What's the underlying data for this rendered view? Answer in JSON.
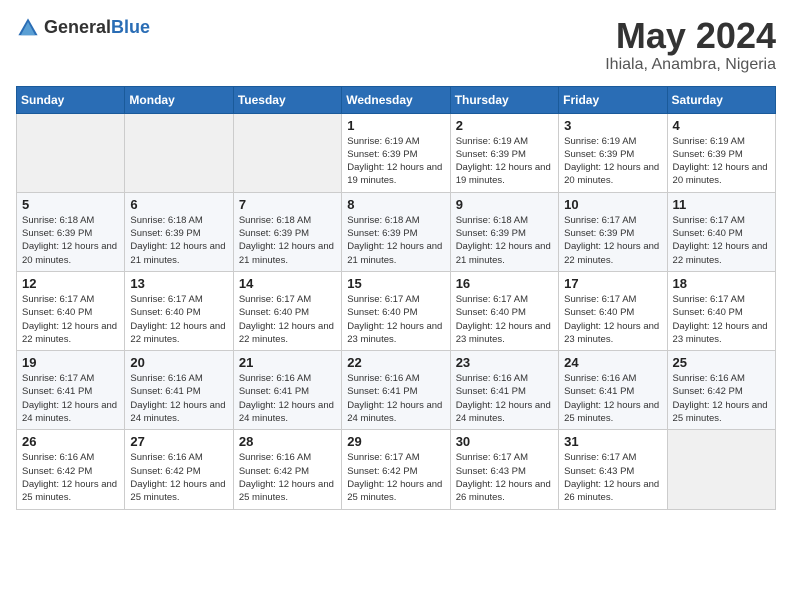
{
  "header": {
    "logo_general": "General",
    "logo_blue": "Blue",
    "month_title": "May 2024",
    "location": "Ihiala, Anambra, Nigeria"
  },
  "days_of_week": [
    "Sunday",
    "Monday",
    "Tuesday",
    "Wednesday",
    "Thursday",
    "Friday",
    "Saturday"
  ],
  "weeks": [
    [
      {
        "day": "",
        "sunrise": "",
        "sunset": "",
        "daylight": ""
      },
      {
        "day": "",
        "sunrise": "",
        "sunset": "",
        "daylight": ""
      },
      {
        "day": "",
        "sunrise": "",
        "sunset": "",
        "daylight": ""
      },
      {
        "day": "1",
        "sunrise": "Sunrise: 6:19 AM",
        "sunset": "Sunset: 6:39 PM",
        "daylight": "Daylight: 12 hours and 19 minutes."
      },
      {
        "day": "2",
        "sunrise": "Sunrise: 6:19 AM",
        "sunset": "Sunset: 6:39 PM",
        "daylight": "Daylight: 12 hours and 19 minutes."
      },
      {
        "day": "3",
        "sunrise": "Sunrise: 6:19 AM",
        "sunset": "Sunset: 6:39 PM",
        "daylight": "Daylight: 12 hours and 20 minutes."
      },
      {
        "day": "4",
        "sunrise": "Sunrise: 6:19 AM",
        "sunset": "Sunset: 6:39 PM",
        "daylight": "Daylight: 12 hours and 20 minutes."
      }
    ],
    [
      {
        "day": "5",
        "sunrise": "Sunrise: 6:18 AM",
        "sunset": "Sunset: 6:39 PM",
        "daylight": "Daylight: 12 hours and 20 minutes."
      },
      {
        "day": "6",
        "sunrise": "Sunrise: 6:18 AM",
        "sunset": "Sunset: 6:39 PM",
        "daylight": "Daylight: 12 hours and 21 minutes."
      },
      {
        "day": "7",
        "sunrise": "Sunrise: 6:18 AM",
        "sunset": "Sunset: 6:39 PM",
        "daylight": "Daylight: 12 hours and 21 minutes."
      },
      {
        "day": "8",
        "sunrise": "Sunrise: 6:18 AM",
        "sunset": "Sunset: 6:39 PM",
        "daylight": "Daylight: 12 hours and 21 minutes."
      },
      {
        "day": "9",
        "sunrise": "Sunrise: 6:18 AM",
        "sunset": "Sunset: 6:39 PM",
        "daylight": "Daylight: 12 hours and 21 minutes."
      },
      {
        "day": "10",
        "sunrise": "Sunrise: 6:17 AM",
        "sunset": "Sunset: 6:39 PM",
        "daylight": "Daylight: 12 hours and 22 minutes."
      },
      {
        "day": "11",
        "sunrise": "Sunrise: 6:17 AM",
        "sunset": "Sunset: 6:40 PM",
        "daylight": "Daylight: 12 hours and 22 minutes."
      }
    ],
    [
      {
        "day": "12",
        "sunrise": "Sunrise: 6:17 AM",
        "sunset": "Sunset: 6:40 PM",
        "daylight": "Daylight: 12 hours and 22 minutes."
      },
      {
        "day": "13",
        "sunrise": "Sunrise: 6:17 AM",
        "sunset": "Sunset: 6:40 PM",
        "daylight": "Daylight: 12 hours and 22 minutes."
      },
      {
        "day": "14",
        "sunrise": "Sunrise: 6:17 AM",
        "sunset": "Sunset: 6:40 PM",
        "daylight": "Daylight: 12 hours and 22 minutes."
      },
      {
        "day": "15",
        "sunrise": "Sunrise: 6:17 AM",
        "sunset": "Sunset: 6:40 PM",
        "daylight": "Daylight: 12 hours and 23 minutes."
      },
      {
        "day": "16",
        "sunrise": "Sunrise: 6:17 AM",
        "sunset": "Sunset: 6:40 PM",
        "daylight": "Daylight: 12 hours and 23 minutes."
      },
      {
        "day": "17",
        "sunrise": "Sunrise: 6:17 AM",
        "sunset": "Sunset: 6:40 PM",
        "daylight": "Daylight: 12 hours and 23 minutes."
      },
      {
        "day": "18",
        "sunrise": "Sunrise: 6:17 AM",
        "sunset": "Sunset: 6:40 PM",
        "daylight": "Daylight: 12 hours and 23 minutes."
      }
    ],
    [
      {
        "day": "19",
        "sunrise": "Sunrise: 6:17 AM",
        "sunset": "Sunset: 6:41 PM",
        "daylight": "Daylight: 12 hours and 24 minutes."
      },
      {
        "day": "20",
        "sunrise": "Sunrise: 6:16 AM",
        "sunset": "Sunset: 6:41 PM",
        "daylight": "Daylight: 12 hours and 24 minutes."
      },
      {
        "day": "21",
        "sunrise": "Sunrise: 6:16 AM",
        "sunset": "Sunset: 6:41 PM",
        "daylight": "Daylight: 12 hours and 24 minutes."
      },
      {
        "day": "22",
        "sunrise": "Sunrise: 6:16 AM",
        "sunset": "Sunset: 6:41 PM",
        "daylight": "Daylight: 12 hours and 24 minutes."
      },
      {
        "day": "23",
        "sunrise": "Sunrise: 6:16 AM",
        "sunset": "Sunset: 6:41 PM",
        "daylight": "Daylight: 12 hours and 24 minutes."
      },
      {
        "day": "24",
        "sunrise": "Sunrise: 6:16 AM",
        "sunset": "Sunset: 6:41 PM",
        "daylight": "Daylight: 12 hours and 25 minutes."
      },
      {
        "day": "25",
        "sunrise": "Sunrise: 6:16 AM",
        "sunset": "Sunset: 6:42 PM",
        "daylight": "Daylight: 12 hours and 25 minutes."
      }
    ],
    [
      {
        "day": "26",
        "sunrise": "Sunrise: 6:16 AM",
        "sunset": "Sunset: 6:42 PM",
        "daylight": "Daylight: 12 hours and 25 minutes."
      },
      {
        "day": "27",
        "sunrise": "Sunrise: 6:16 AM",
        "sunset": "Sunset: 6:42 PM",
        "daylight": "Daylight: 12 hours and 25 minutes."
      },
      {
        "day": "28",
        "sunrise": "Sunrise: 6:16 AM",
        "sunset": "Sunset: 6:42 PM",
        "daylight": "Daylight: 12 hours and 25 minutes."
      },
      {
        "day": "29",
        "sunrise": "Sunrise: 6:17 AM",
        "sunset": "Sunset: 6:42 PM",
        "daylight": "Daylight: 12 hours and 25 minutes."
      },
      {
        "day": "30",
        "sunrise": "Sunrise: 6:17 AM",
        "sunset": "Sunset: 6:43 PM",
        "daylight": "Daylight: 12 hours and 26 minutes."
      },
      {
        "day": "31",
        "sunrise": "Sunrise: 6:17 AM",
        "sunset": "Sunset: 6:43 PM",
        "daylight": "Daylight: 12 hours and 26 minutes."
      },
      {
        "day": "",
        "sunrise": "",
        "sunset": "",
        "daylight": ""
      }
    ]
  ]
}
